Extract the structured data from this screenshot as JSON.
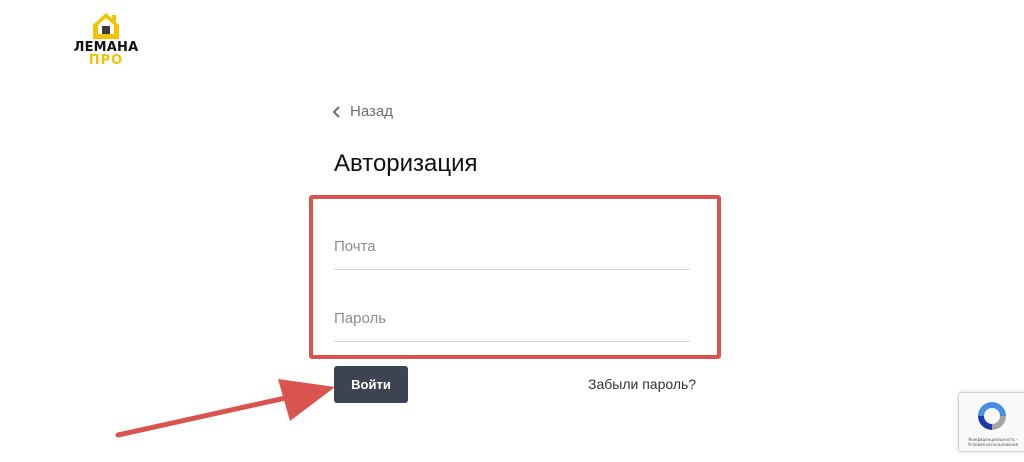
{
  "logo": {
    "line1": "ЛЕМАНА",
    "line2": "ПРО",
    "icon": "house-logo-icon"
  },
  "back": {
    "label": "Назад",
    "icon": "chevron-left-icon"
  },
  "title": "Авторизация",
  "form": {
    "email_placeholder": "Почта",
    "email_value": "",
    "password_placeholder": "Пароль",
    "password_value": ""
  },
  "actions": {
    "login_label": "Войти",
    "forgot_label": "Забыли пароль?"
  },
  "recaptcha": {
    "icon": "recaptcha-icon",
    "text": "Конфиденциальность - Условия использования"
  },
  "colors": {
    "brand_yellow": "#f2c300",
    "button_bg": "#3d4451",
    "annotation_red": "#d9534f"
  }
}
